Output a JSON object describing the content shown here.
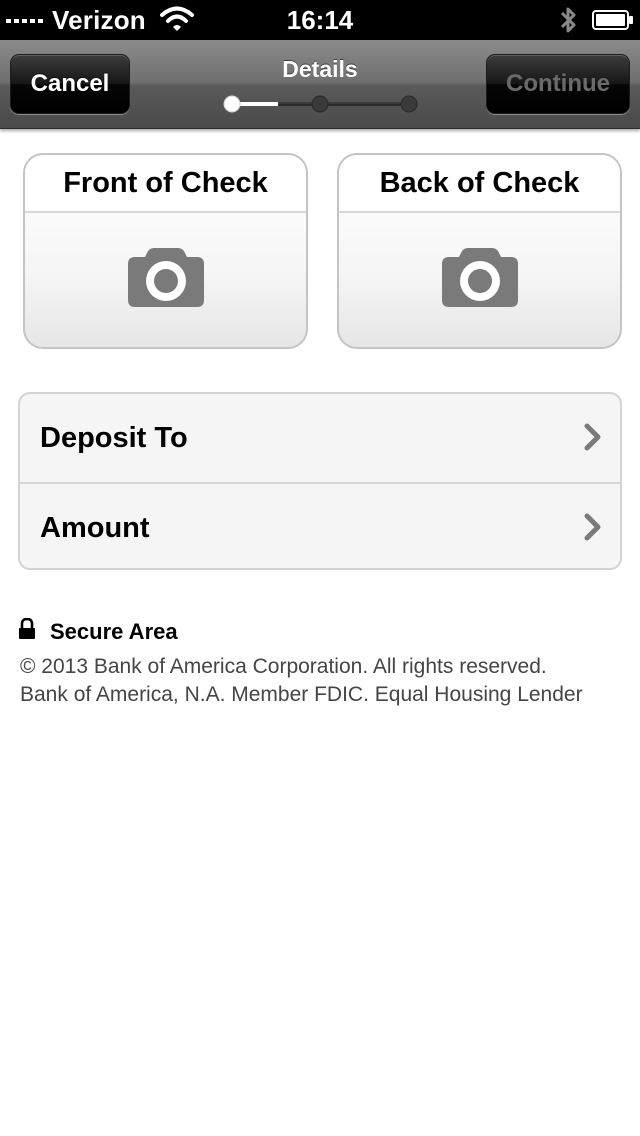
{
  "status_bar": {
    "carrier": "Verizon",
    "time": "16:14",
    "signal_bars": 5,
    "signal_icon": "signal-icon",
    "wifi_icon": "wifi-icon",
    "bluetooth_icon": "bluetooth-icon",
    "battery_icon": "battery-icon"
  },
  "nav": {
    "title": "Details",
    "cancel_label": "Cancel",
    "continue_label": "Continue",
    "progress": {
      "total_steps": 3,
      "current_step": 1
    }
  },
  "check_tiles": [
    {
      "label": "Front of Check",
      "icon": "camera-icon"
    },
    {
      "label": "Back of Check",
      "icon": "camera-icon"
    }
  ],
  "rows": [
    {
      "label": "Deposit To",
      "icon": "chevron-right-icon"
    },
    {
      "label": "Amount",
      "icon": "chevron-right-icon"
    }
  ],
  "footer": {
    "secure_label": "Secure Area",
    "secure_icon": "lock-icon",
    "copyright_line1": "© 2013  Bank of America Corporation. All rights reserved.",
    "copyright_line2": "Bank of America, N.A. Member FDIC. Equal Housing Lender"
  },
  "colors": {
    "nav_gradient_top": "#8b8b8b",
    "nav_gradient_bottom": "#4a4a4a",
    "button_bg": "#000000",
    "continue_disabled_text": "#6a6a6a",
    "camera_gray": "#7a7a7a"
  }
}
